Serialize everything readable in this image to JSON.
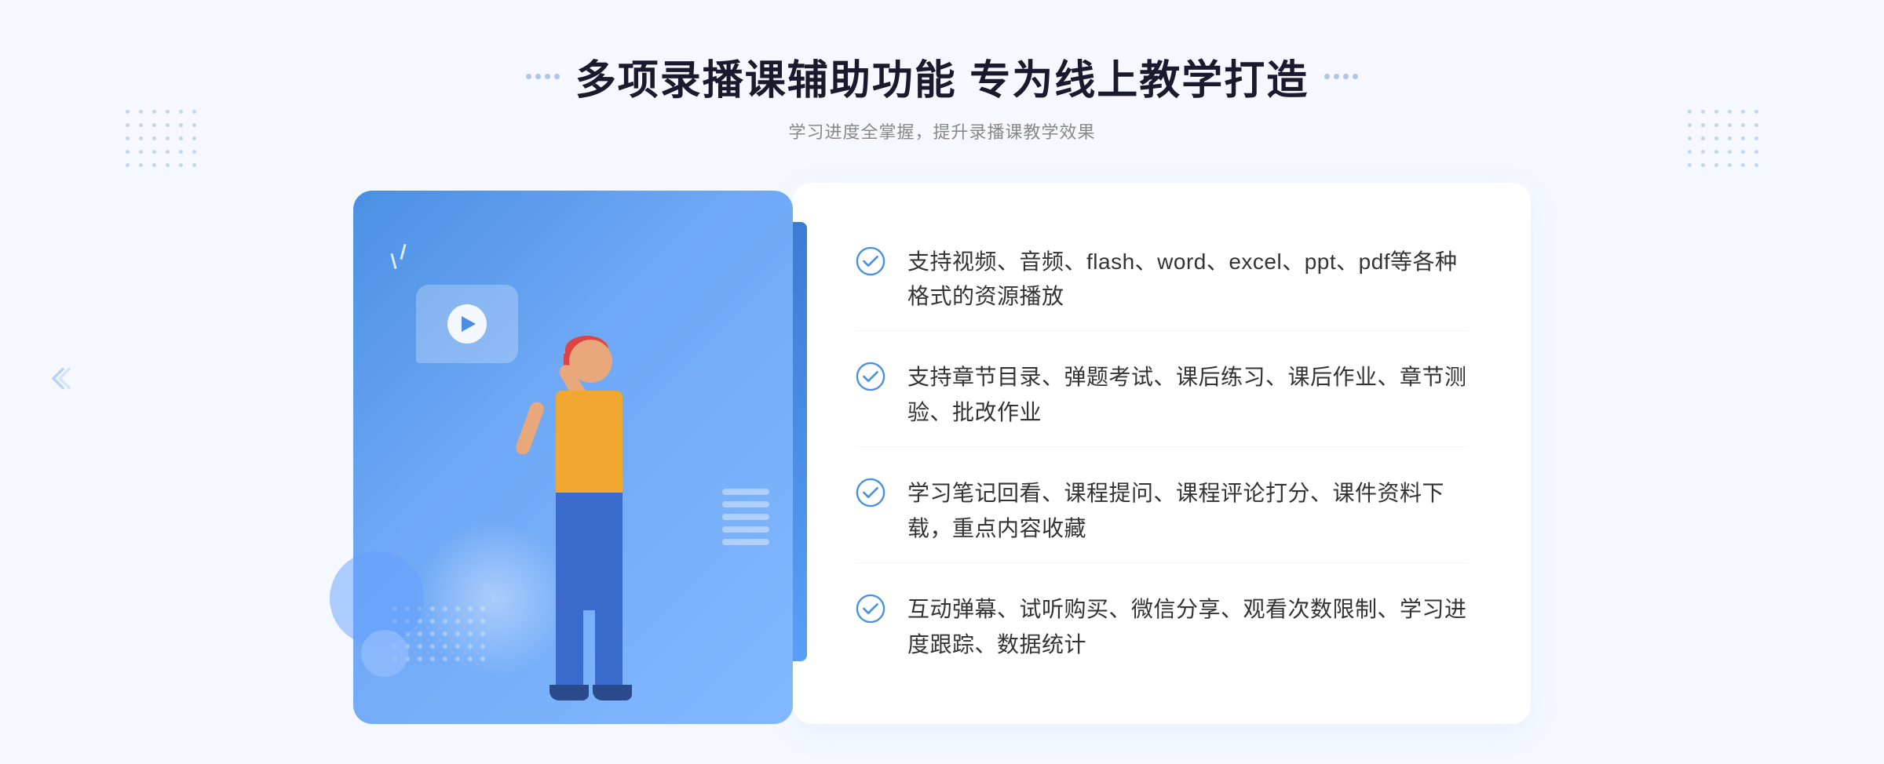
{
  "header": {
    "main_title": "多项录播课辅助功能 专为线上教学打造",
    "sub_title": "学习进度全掌握，提升录播课教学效果"
  },
  "features": [
    {
      "id": 1,
      "text": "支持视频、音频、flash、word、excel、ppt、pdf等各种格式的资源播放"
    },
    {
      "id": 2,
      "text": "支持章节目录、弹题考试、课后练习、课后作业、章节测验、批改作业"
    },
    {
      "id": 3,
      "text": "学习笔记回看、课程提问、课程评论打分、课件资料下载，重点内容收藏"
    },
    {
      "id": 4,
      "text": "互动弹幕、试听购买、微信分享、观看次数限制、学习进度跟踪、数据统计"
    }
  ],
  "colors": {
    "accent": "#4a90e2",
    "title": "#1a1a2e",
    "subtitle": "#888888",
    "feature_text": "#333333",
    "check_color": "#4a90e2"
  },
  "icons": {
    "check": "check-circle-icon",
    "play": "play-icon",
    "arrow_left": "arrow-left-icon"
  }
}
